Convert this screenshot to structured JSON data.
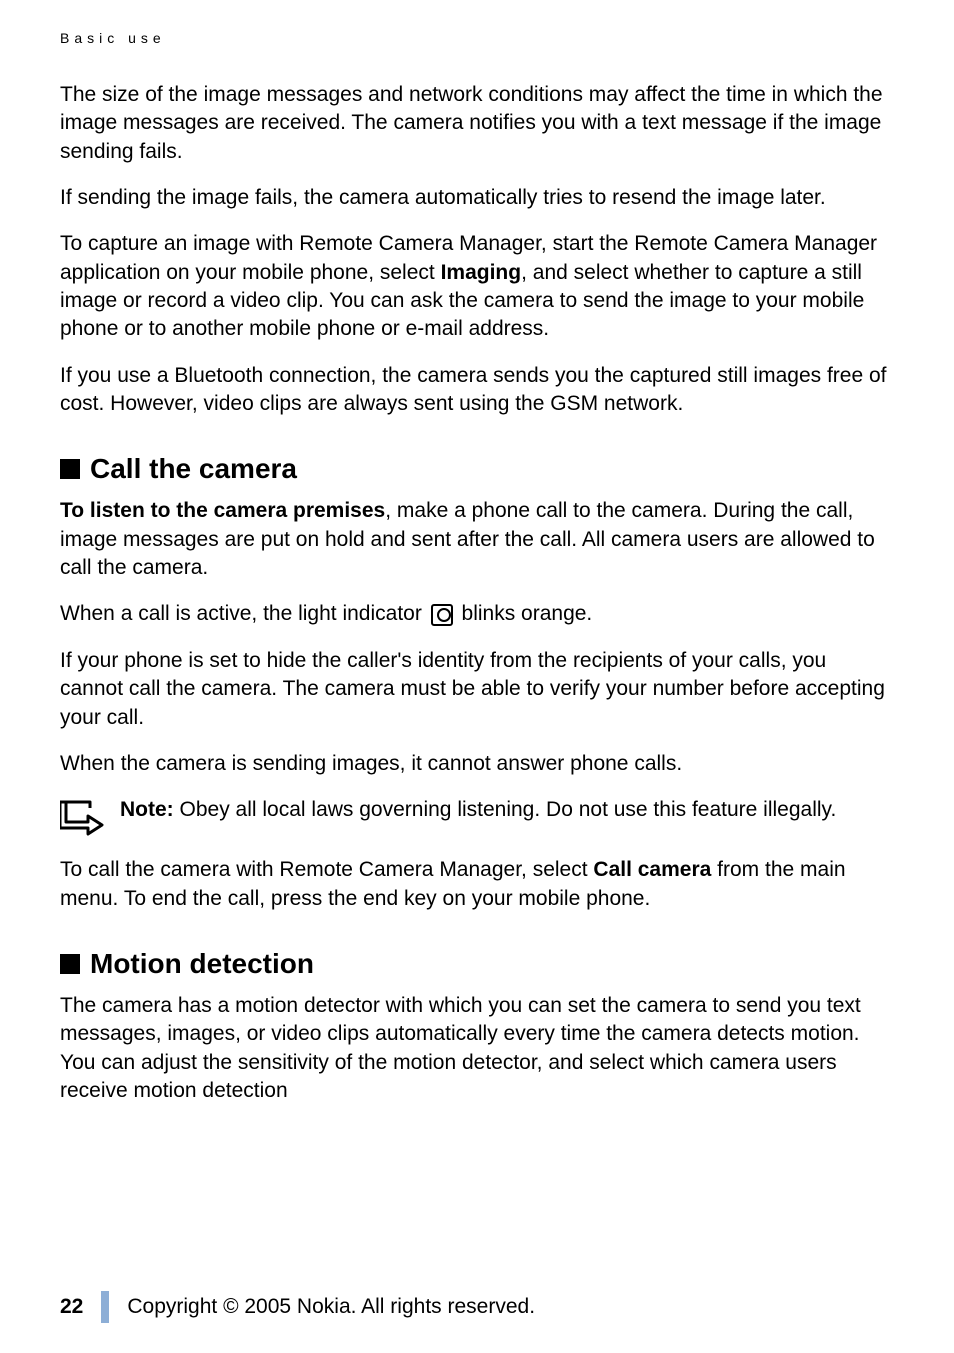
{
  "header": {
    "label": "Basic use"
  },
  "paragraphs": {
    "p1": "The size of the image messages and network conditions may affect the time in which the image messages are received. The camera notifies you with a text message if the image sending fails.",
    "p2": "If sending the image fails, the camera automatically tries to resend the image later.",
    "p3_part1": "To capture an image with Remote Camera Manager, start the Remote Camera Manager application on your mobile phone, select ",
    "p3_bold": "Imaging",
    "p3_part2": ", and select whether to capture a still image or record a video clip. You can ask the camera to send the image to your mobile phone or to another mobile phone or e-mail address.",
    "p4": "If you use a Bluetooth connection, the camera sends you the captured still images free of cost. However, video clips are always sent using the GSM network.",
    "p5_bold": "To listen to the camera premises",
    "p5_part2": ", make a phone call to the camera. During the call, image messages are put on hold and sent after the call. All camera users are allowed to call the camera.",
    "p6_part1": "When a call is active, the light indicator ",
    "p6_part2": " blinks orange.",
    "p7": "If your phone is set to hide the caller's identity from the recipients of your calls, you cannot call the camera. The camera must be able to verify your number before accepting your call.",
    "p8": "When the camera is sending images, it cannot answer phone calls.",
    "p9_part1": "To call the camera with Remote Camera Manager, select ",
    "p9_bold": "Call camera",
    "p9_part2": " from the main menu. To end the call, press the end key on your mobile phone.",
    "p10": "The camera has a motion detector with which you can set the camera to send you text messages, images, or video clips automatically every time the camera detects motion. You can adjust the sensitivity of the motion detector, and select which camera users receive motion detection"
  },
  "sections": {
    "s1": "Call the camera",
    "s2": "Motion detection"
  },
  "note": {
    "label": "Note:",
    "text": " Obey all local laws governing listening. Do not use this feature illegally."
  },
  "footer": {
    "page": "22",
    "copyright": "Copyright © 2005 Nokia. All rights reserved."
  }
}
